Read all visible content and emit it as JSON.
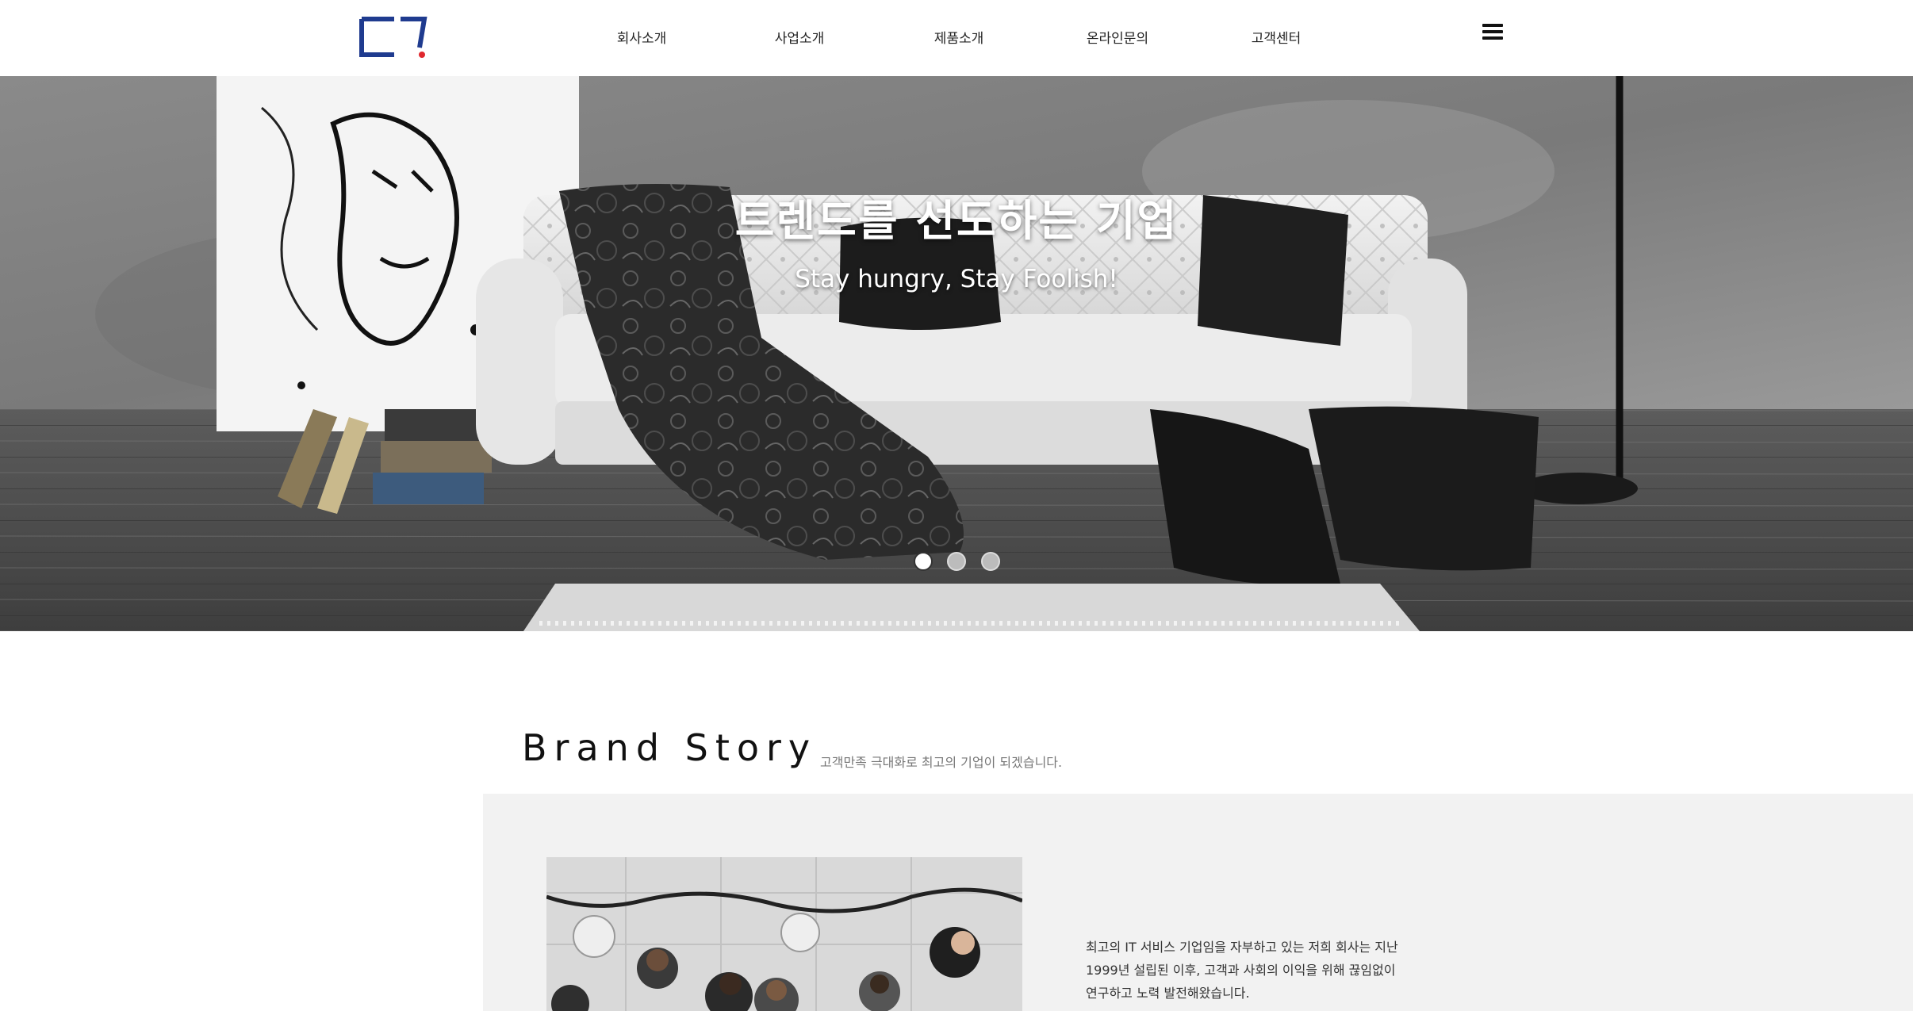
{
  "header": {
    "logo_alt": "logo",
    "nav": [
      {
        "label": "회사소개"
      },
      {
        "label": "사업소개"
      },
      {
        "label": "제품소개"
      },
      {
        "label": "온라인문의"
      },
      {
        "label": "고객센터"
      }
    ],
    "menu_icon": "hamburger-menu-icon"
  },
  "hero": {
    "title": "트렌드를 선도하는 기업",
    "subtitle": "Stay hungry, Stay Foolish!",
    "slides_count": 3,
    "active_slide": 1
  },
  "brand": {
    "title": "Brand  Story",
    "description": "고객만족 극대화로 최고의 기업이 되겠습니다.",
    "text_lines": [
      "최고의 IT 서비스 기업임을 자부하고 있는 저희 회사는 지난",
      "1999년 설립된 이후, 고객과 사회의 이익을 위해 끊임없이",
      "연구하고 노력 발전해왔습니다."
    ]
  },
  "colors": {
    "logo_blue": "#1f3b8f",
    "logo_red": "#e0282e",
    "panel_bg": "#f2f2f2"
  }
}
